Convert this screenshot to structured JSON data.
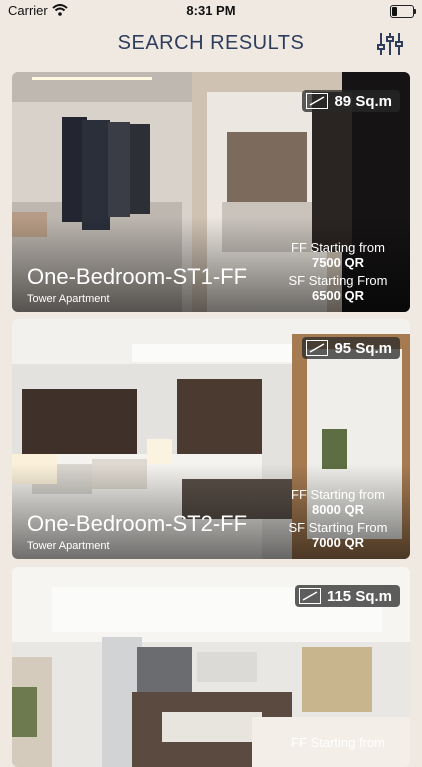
{
  "status_bar": {
    "carrier": "Carrier",
    "time": "8:31 PM"
  },
  "header": {
    "title": "SEARCH RESULTS"
  },
  "listings": [
    {
      "area": "89 Sq.m",
      "name": "One-Bedroom-ST1-FF",
      "type": "Tower Apartment",
      "ff_label": "FF Starting from",
      "ff_price": "7500 QR",
      "sf_label": "SF Starting From",
      "sf_price": "6500 QR"
    },
    {
      "area": "95 Sq.m",
      "name": "One-Bedroom-ST2-FF",
      "type": "Tower Apartment",
      "ff_label": "FF Starting from",
      "ff_price": "8000 QR",
      "sf_label": "SF Starting From",
      "sf_price": "7000 QR"
    },
    {
      "area": "115 Sq.m",
      "ff_label": "FF Starting from"
    }
  ],
  "colors": {
    "background": "#efe9e2",
    "title": "#2e3d5b"
  }
}
